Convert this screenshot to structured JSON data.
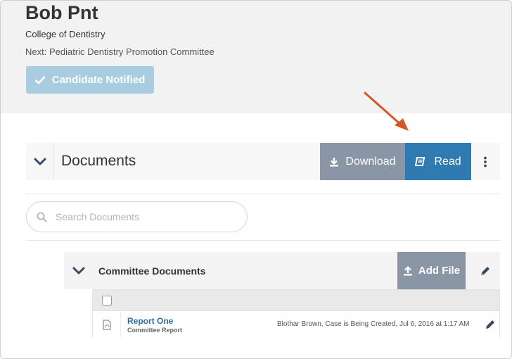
{
  "candidate": {
    "name": "Bob Pnt",
    "college": "College of Dentistry",
    "next": "Next: Pediatric Dentistry Promotion Committee",
    "status_button": "Candidate Notified"
  },
  "documents": {
    "title": "Documents",
    "download_label": "Download",
    "read_label": "Read",
    "search_placeholder": "Search Documents"
  },
  "committee": {
    "title": "Committee Documents",
    "add_file_label": "Add File",
    "files": [
      {
        "title": "Report One",
        "subtitle": "Committee Report",
        "meta": "Blothar Brown, Case is Being Created, Jul 6, 2016 at 1:17 AM"
      }
    ]
  },
  "colors": {
    "read_button": "#2e7ab1",
    "gray_button": "#8a95a6",
    "notified_button": "#a8cde0",
    "annotation_arrow": "#d4572a",
    "link": "#2e6da4"
  },
  "icons": [
    "check-icon",
    "download-icon",
    "book-icon",
    "more-vertical-icon",
    "search-icon",
    "chevron-down-icon",
    "upload-icon",
    "pencil-icon",
    "pdf-file-icon"
  ]
}
